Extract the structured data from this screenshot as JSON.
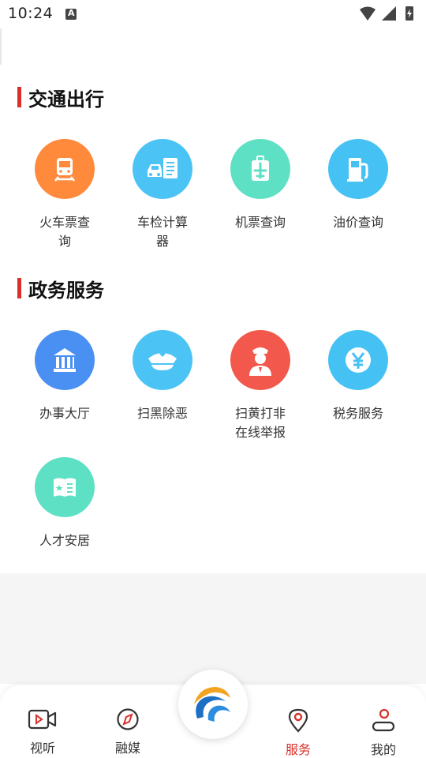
{
  "status_bar": {
    "time": "10:24",
    "notification_icon": "a-icon"
  },
  "sections": [
    {
      "title": "交通出行",
      "items": [
        {
          "label": "火车票查询",
          "icon": "train-icon",
          "color": "#ff8a3c"
        },
        {
          "label": "车检计算器",
          "icon": "car-inspection-icon",
          "color": "#4cc3f5"
        },
        {
          "label": "机票查询",
          "icon": "plane-ticket-icon",
          "color": "#5de0c3"
        },
        {
          "label": "油价查询",
          "icon": "fuel-pump-icon",
          "color": "#46c1f3"
        }
      ]
    },
    {
      "title": "政务服务",
      "items": [
        {
          "label": "办事大厅",
          "icon": "government-hall-icon",
          "color": "#4a8ff2"
        },
        {
          "label": "扫黑除恶",
          "icon": "police-cap-icon",
          "color": "#4cc3f5"
        },
        {
          "label": "扫黄打非在线举报",
          "icon": "police-officer-icon",
          "color": "#f2584c"
        },
        {
          "label": "税务服务",
          "icon": "yuan-coin-icon",
          "color": "#46c1f3"
        },
        {
          "label": "人才安居",
          "icon": "talent-book-icon",
          "color": "#5de0c3"
        }
      ]
    }
  ],
  "bottom_nav": {
    "items": [
      {
        "label": "视听",
        "icon": "video-camera-icon"
      },
      {
        "label": "融媒",
        "icon": "compass-icon"
      },
      {
        "label": "服务",
        "icon": "location-pin-icon",
        "active": true
      },
      {
        "label": "我的",
        "icon": "user-icon"
      }
    ],
    "center_icon": "app-logo-icon",
    "accent_color": "#d9302a"
  }
}
